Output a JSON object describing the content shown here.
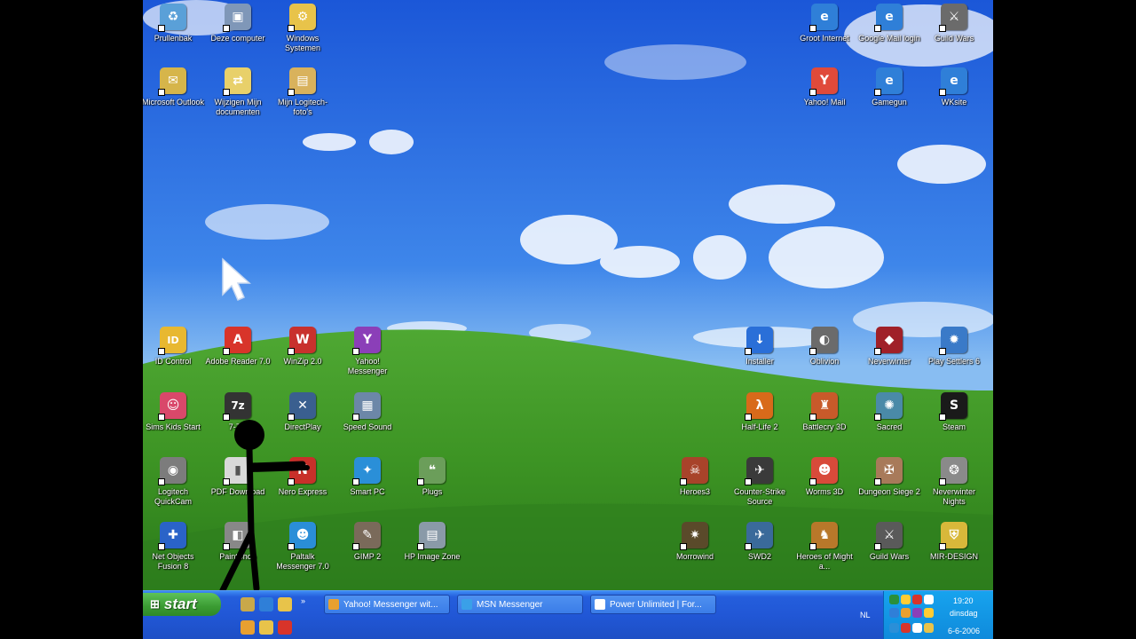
{
  "desktop": {
    "icons": [
      {
        "label": "Prullenbak",
        "color": "#5aa0d8",
        "glyph": "♻"
      },
      {
        "label": "Deze computer",
        "color": "#7f97b8",
        "glyph": "▣"
      },
      {
        "label": "Windows Systemen",
        "color": "#e8c34a",
        "glyph": "⚙"
      },
      {
        "label": "Microsoft Outlook",
        "color": "#d6b54a",
        "glyph": "✉"
      },
      {
        "label": "Wijzigen Mijn documenten",
        "color": "#e8d06a",
        "glyph": "⇄"
      },
      {
        "label": "Mijn Logitech-foto's",
        "color": "#d9b25c",
        "glyph": "▤"
      },
      {
        "label": "Groot Internet",
        "color": "#2f7fd8",
        "glyph": "e"
      },
      {
        "label": "Google Mail login",
        "color": "#2f7fd8",
        "glyph": "e"
      },
      {
        "label": "Guild Wars",
        "color": "#6b6b6b",
        "glyph": "⚔"
      },
      {
        "label": "Yahoo! Mail",
        "color": "#e04a3a",
        "glyph": "Y"
      },
      {
        "label": "Gamegun",
        "color": "#2f7fd8",
        "glyph": "e"
      },
      {
        "label": "WKsite",
        "color": "#2f7fd8",
        "glyph": "e"
      },
      {
        "label": "ID Control",
        "color": "#e8b830",
        "glyph": "ID"
      },
      {
        "label": "Adobe Reader 7.0",
        "color": "#d8342a",
        "glyph": "A"
      },
      {
        "label": "WinZip 2.0",
        "color": "#c8312d",
        "glyph": "W"
      },
      {
        "label": "Yahoo! Messenger",
        "color": "#8b3fb8",
        "glyph": "Y"
      },
      {
        "label": "Sims Kids Start",
        "color": "#d9486a",
        "glyph": "☺"
      },
      {
        "label": "7-Zip",
        "color": "#333333",
        "glyph": "7z"
      },
      {
        "label": "DirectPlay",
        "color": "#3a5f8f",
        "glyph": "✕"
      },
      {
        "label": "Speed Sound",
        "color": "#6c87a8",
        "glyph": "▦"
      },
      {
        "label": "Logitech QuickCam",
        "color": "#7c7c7c",
        "glyph": "◉"
      },
      {
        "label": "PDF Download",
        "color": "#d9d9d9",
        "glyph": "▮"
      },
      {
        "label": "Nero Express",
        "color": "#c8302a",
        "glyph": "N"
      },
      {
        "label": "Smart PC",
        "color": "#2a8fd8",
        "glyph": "✦"
      },
      {
        "label": "Plugs",
        "color": "#6b9e5a",
        "glyph": "❝"
      },
      {
        "label": "Net Objects Fusion 8",
        "color": "#2a63c8",
        "glyph": "✚"
      },
      {
        "label": "PaintShop",
        "color": "#888888",
        "glyph": "◧"
      },
      {
        "label": "Paltalk Messenger 7.0",
        "color": "#2a8ed8",
        "glyph": "☻"
      },
      {
        "label": "GIMP 2",
        "color": "#7a6a5a",
        "glyph": "✎"
      },
      {
        "label": "HP Image Zone",
        "color": "#8a9aa8",
        "glyph": "▤"
      },
      {
        "label": "Installer",
        "color": "#2a6fd8",
        "glyph": "↓"
      },
      {
        "label": "Oblivion",
        "color": "#6b6b6b",
        "glyph": "◐"
      },
      {
        "label": "Neverwinter",
        "color": "#a02028",
        "glyph": "◆"
      },
      {
        "label": "Play Settlers 6",
        "color": "#3a7ac8",
        "glyph": "✹"
      },
      {
        "label": "Half-Life 2",
        "color": "#d86a1a",
        "glyph": "λ"
      },
      {
        "label": "Battlecry 3D",
        "color": "#c85a2a",
        "glyph": "♜"
      },
      {
        "label": "Sacred",
        "color": "#4a8aa8",
        "glyph": "✺"
      },
      {
        "label": "Steam",
        "color": "#1a1a1a",
        "glyph": "S"
      },
      {
        "label": "Heroes3",
        "color": "#a8432a",
        "glyph": "☠"
      },
      {
        "label": "Counter-Strike Source",
        "color": "#3a3a3a",
        "glyph": "✈"
      },
      {
        "label": "Worms 3D",
        "color": "#d84a3a",
        "glyph": "☻"
      },
      {
        "label": "Dungeon Siege 2",
        "color": "#a87a5a",
        "glyph": "✠"
      },
      {
        "label": "Neverwinter Nights",
        "color": "#8a8a8a",
        "glyph": "❂"
      },
      {
        "label": "Morrowind",
        "color": "#5a4a2a",
        "glyph": "✷"
      },
      {
        "label": "SWD2",
        "color": "#3a6a9a",
        "glyph": "✈"
      },
      {
        "label": "Heroes of Might a...",
        "color": "#b8782a",
        "glyph": "♞"
      },
      {
        "label": "Guild Wars",
        "color": "#5a5a5a",
        "glyph": "⚔"
      },
      {
        "label": "MIR-DESIGN",
        "color": "#d8b83a",
        "glyph": "⛨"
      }
    ]
  },
  "taskbar": {
    "start_label": "start",
    "quick_launch": [
      {
        "name": "show-desktop",
        "color": "#c9a84a"
      },
      {
        "name": "internet-explorer",
        "color": "#2f7fd8"
      },
      {
        "name": "outlook-express",
        "color": "#e8c34a"
      },
      {
        "name": "messenger",
        "color": "#e8a030"
      },
      {
        "name": "folder",
        "color": "#e8c34a"
      },
      {
        "name": "media",
        "color": "#d8342a"
      }
    ],
    "tasks": [
      {
        "label": "Yahoo! Messenger wit...",
        "color": "#e8a030"
      },
      {
        "label": "MSN Messenger",
        "color": "#3aa0e8"
      },
      {
        "label": "Power Unlimited | For...",
        "color": "#ffffff"
      }
    ]
  },
  "tray": {
    "language": "NL",
    "time": "19:20",
    "day": "dinsdag",
    "date": "6-6-2006",
    "icon_colors": [
      "#2a8f3a",
      "#ffcc33",
      "#d8342a",
      "#ffffff",
      "#2f7fd8",
      "#e8a030",
      "#8b3fb8",
      "#ffcc33",
      "#2a8fd8",
      "#d8342a",
      "#ffffff",
      "#e8c34a"
    ]
  }
}
